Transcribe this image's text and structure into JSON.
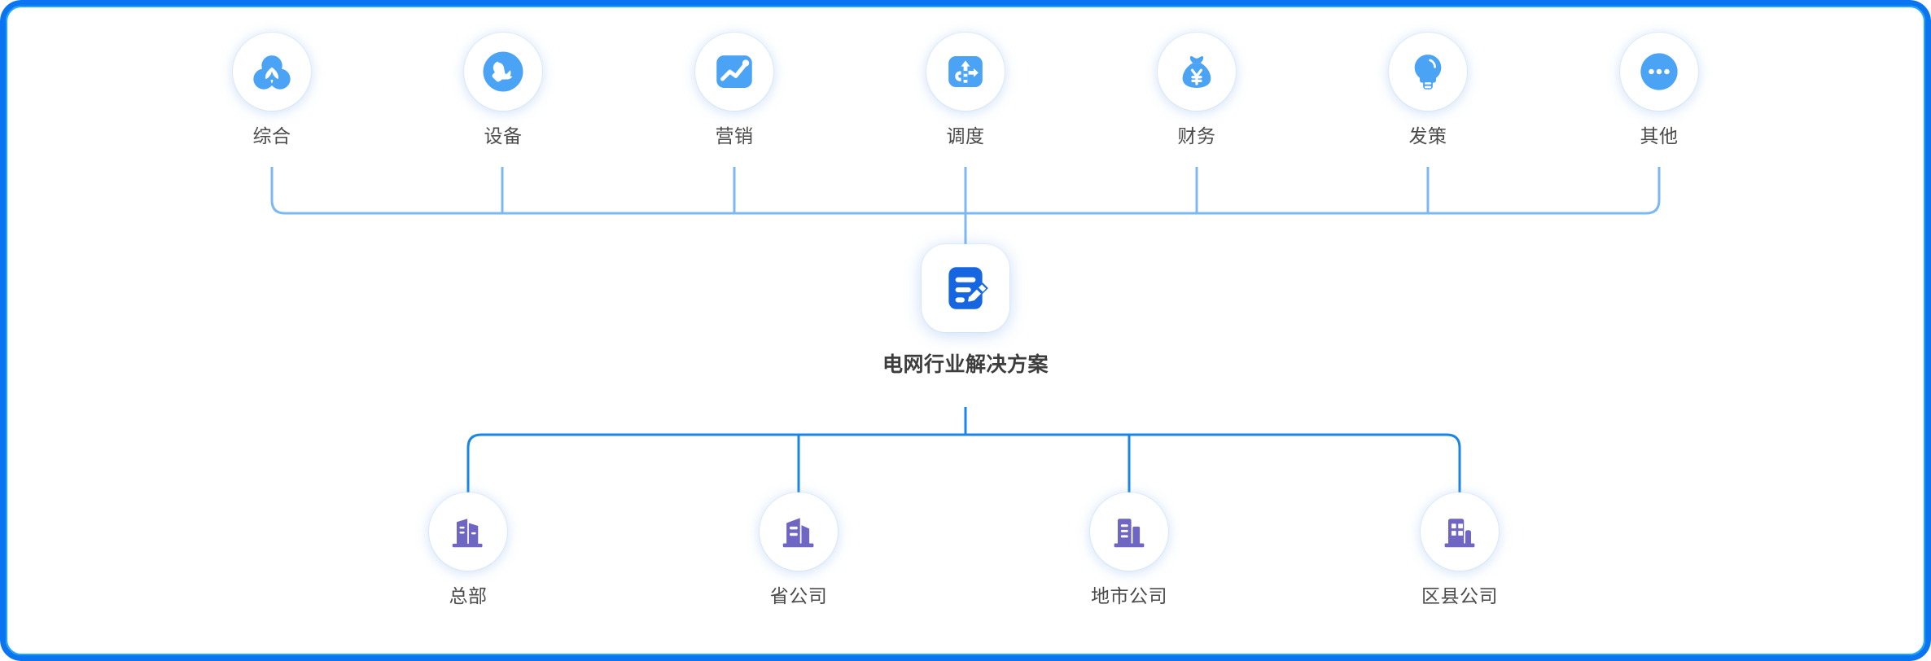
{
  "frame": {
    "accent_color": "#0b74f0",
    "accent_color_inner": "#18a6ff"
  },
  "palette": {
    "icon_blue": "#4aa3f5",
    "center_blue": "#1566e0",
    "building_purple": "#6f66c4",
    "connector_top": "#7cb8f2",
    "connector_bottom": "#1a85e8",
    "label_gray": "#4b4b4b"
  },
  "diagram": {
    "title": "电网行业解决方案",
    "center": {
      "label": "电网行业解决方案",
      "icon": "document-edit-icon"
    },
    "top_nodes": [
      {
        "label": "综合",
        "icon": "venn-circles-icon",
        "shape": "circle"
      },
      {
        "label": "设备",
        "icon": "wrench-icon",
        "shape": "circle"
      },
      {
        "label": "营销",
        "icon": "line-chart-icon",
        "shape": "rounded-square"
      },
      {
        "label": "调度",
        "icon": "dispatch-arrows-icon",
        "shape": "rounded-square"
      },
      {
        "label": "财务",
        "icon": "money-bag-yuan-icon",
        "shape": "plain"
      },
      {
        "label": "发策",
        "icon": "lightbulb-icon",
        "shape": "plain"
      },
      {
        "label": "其他",
        "icon": "ellipsis-circle-icon",
        "shape": "circle"
      }
    ],
    "bottom_nodes": [
      {
        "label": "总部",
        "icon": "buildings-twin-icon"
      },
      {
        "label": "省公司",
        "icon": "buildings-office-icon"
      },
      {
        "label": "地市公司",
        "icon": "buildings-tower-icon"
      },
      {
        "label": "区县公司",
        "icon": "buildings-grid-icon"
      }
    ]
  }
}
